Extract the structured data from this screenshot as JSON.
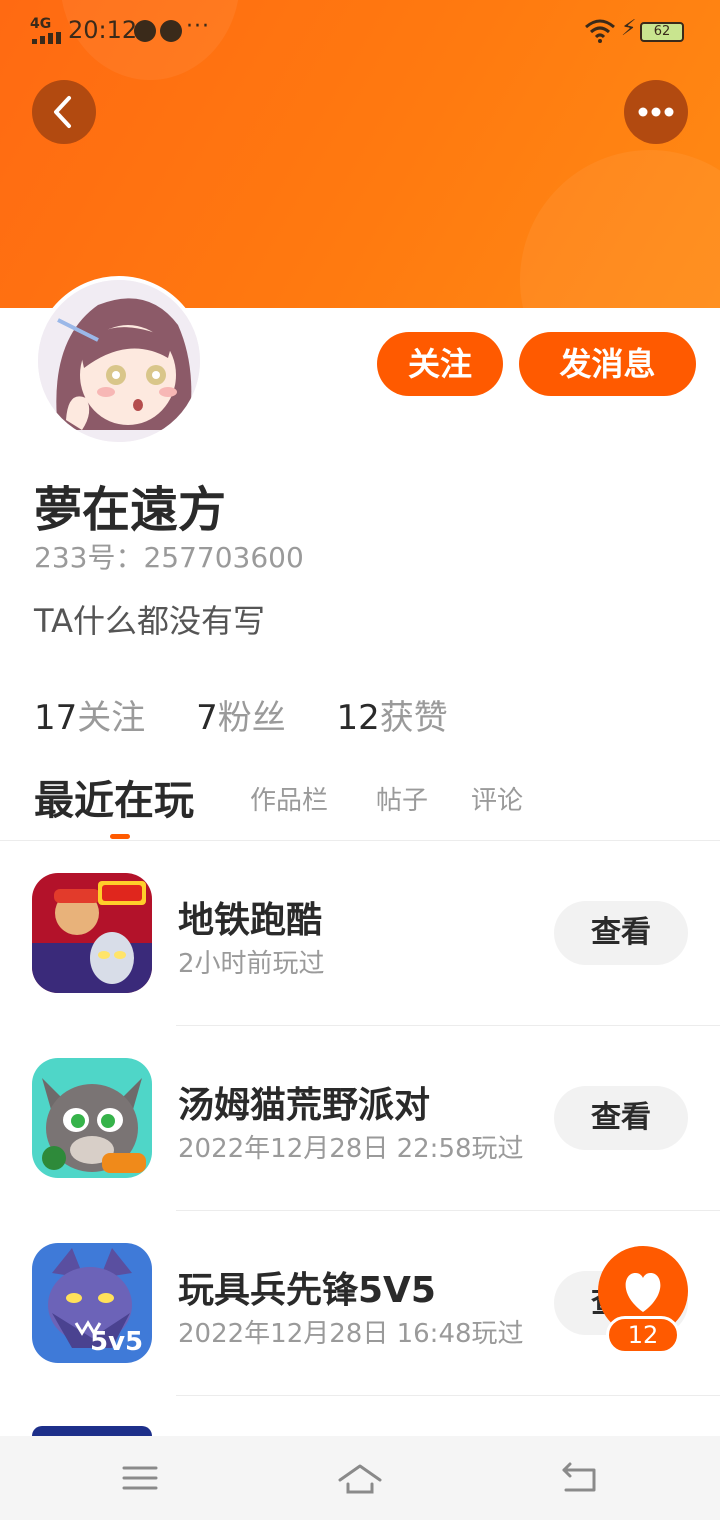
{
  "status_bar": {
    "network": "4G",
    "time": "20:12",
    "more": "···",
    "battery": "62",
    "icons": [
      "signal-icon",
      "message-icon",
      "tiktok-icon",
      "wifi-icon",
      "charging-icon",
      "battery-icon"
    ]
  },
  "header": {
    "back_icon": "chevron-left-icon",
    "more_icon": "more-dots-icon",
    "gradient_colors": [
      "#ff6a12",
      "#ff8a14"
    ]
  },
  "profile": {
    "nickname": "夢在遠方",
    "uid_label": "233号：",
    "uid_value": "257703600",
    "bio": "TA什么都没有写",
    "follow_button": "关注",
    "message_button": "发消息",
    "accent_color": "#ff5a00"
  },
  "stats": {
    "following_count": "17",
    "following_label": "关注",
    "followers_count": "7",
    "followers_label": "粉丝",
    "likes_count": "12",
    "likes_label": "获赞"
  },
  "tabs": [
    {
      "label": "最近在玩",
      "active": true
    },
    {
      "label": "作品栏",
      "active": false
    },
    {
      "label": "帖子",
      "active": false
    },
    {
      "label": "评论",
      "active": false
    }
  ],
  "games": [
    {
      "name": "地铁跑酷",
      "time": "2小时前玩过",
      "button": "查看",
      "icon": "subway-surfers-game-icon"
    },
    {
      "name": "汤姆猫荒野派对",
      "time": "2022年12月28日 22:58玩过",
      "button": "查看",
      "icon": "talking-tom-game-icon"
    },
    {
      "name": "玩具兵先锋5V5",
      "time": "2022年12月28日 16:48玩过",
      "button": "查看",
      "icon": "wolf-5v5-game-icon",
      "icon_badge": "5v5"
    }
  ],
  "like_fab": {
    "count": "12",
    "icon": "heart-icon"
  },
  "nav_bar": {
    "icons": [
      "menu-icon",
      "home-icon",
      "back-icon"
    ]
  }
}
